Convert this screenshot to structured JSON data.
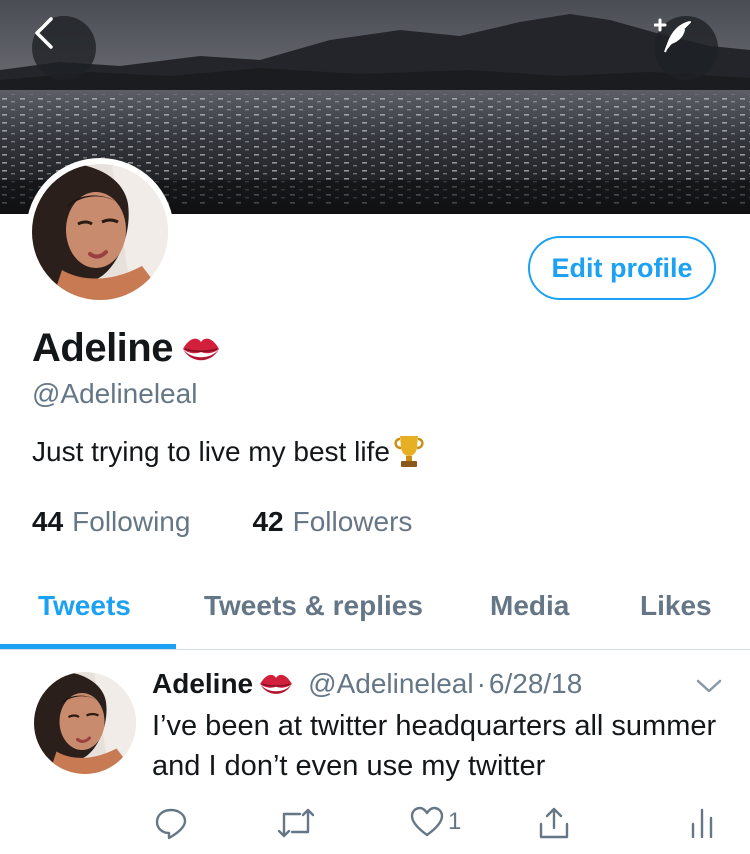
{
  "header": {
    "back_icon": "chevron-left-icon",
    "compose_icon": "compose-tweet-icon"
  },
  "profile": {
    "name": "Adeline",
    "name_emoji": "kiss-mark-emoji",
    "handle": "@Adelineleal",
    "bio": "Just trying to live my best life",
    "bio_emoji": "trophy-emoji",
    "edit_profile_label": "Edit profile",
    "following_count": "44",
    "following_label": "Following",
    "followers_count": "42",
    "followers_label": "Followers"
  },
  "tabs": [
    {
      "label": "Tweets",
      "active": true
    },
    {
      "label": "Tweets & replies",
      "active": false
    },
    {
      "label": "Media",
      "active": false
    },
    {
      "label": "Likes",
      "active": false
    }
  ],
  "tweet": {
    "name": "Adeline",
    "handle": "@Adelineleal",
    "separator": "·",
    "date": "6/28/18",
    "text": "I’ve been at twitter headquarters all summer and I don’t even use my twitter",
    "like_count": "1"
  },
  "colors": {
    "accent": "#1da1f2",
    "secondary_text": "#657786",
    "primary_text": "#14171a",
    "divider": "#d7dde2"
  }
}
